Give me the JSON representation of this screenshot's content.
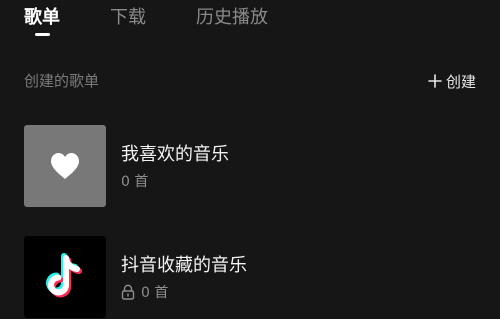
{
  "tabs": [
    {
      "label": "歌单",
      "active": true
    },
    {
      "label": "下载",
      "active": false
    },
    {
      "label": "历史播放",
      "active": false
    }
  ],
  "section": {
    "title": "创建的歌单",
    "create_label": "创建",
    "create_icon": "plus-icon"
  },
  "playlists": [
    {
      "name": "我喜欢的音乐",
      "count_text": "0 首",
      "cover_icon": "heart-icon",
      "locked": false
    },
    {
      "name": "抖音收藏的音乐",
      "count_text": "0 首",
      "cover_icon": "douyin-logo-icon",
      "locked": true,
      "lock_icon": "lock-icon"
    }
  ],
  "colors": {
    "background": "#161616",
    "text_primary": "#f2f2f2",
    "text_secondary": "#8e8e8e",
    "liked_cover": "#787878",
    "douyin_cyan": "#25f4ee",
    "douyin_red": "#fe2c55"
  }
}
